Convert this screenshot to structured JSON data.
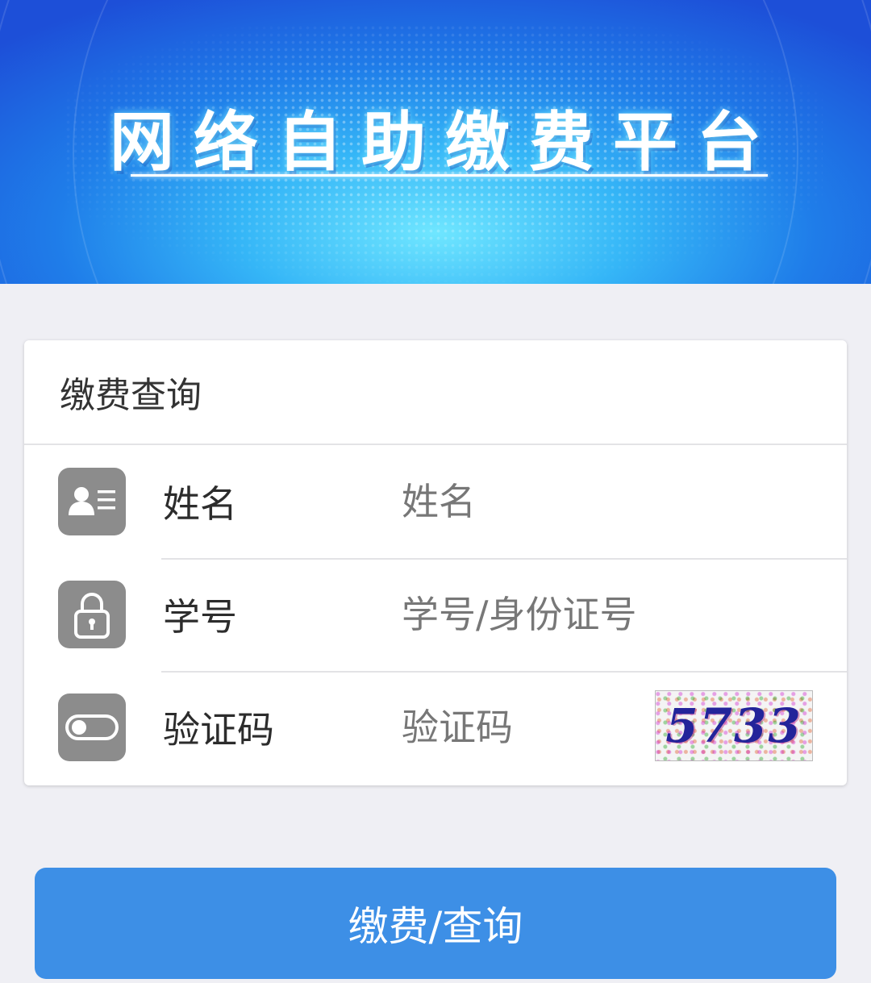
{
  "banner": {
    "title": "网络自助缴费平台"
  },
  "form": {
    "header": "缴费查询",
    "fields": [
      {
        "label": "姓名",
        "placeholder": "姓名",
        "icon": "id-card-icon"
      },
      {
        "label": "学号",
        "placeholder": "学号/身份证号",
        "icon": "lock-icon"
      },
      {
        "label": "验证码",
        "placeholder": "验证码",
        "icon": "toggle-icon"
      }
    ],
    "captcha_text": "5733"
  },
  "submit_label": "缴费/查询",
  "colors": {
    "button": "#3d8fe6",
    "icon_bg": "#8c8c8c",
    "page_bg": "#efeff4",
    "banner": "#1f7de9"
  }
}
